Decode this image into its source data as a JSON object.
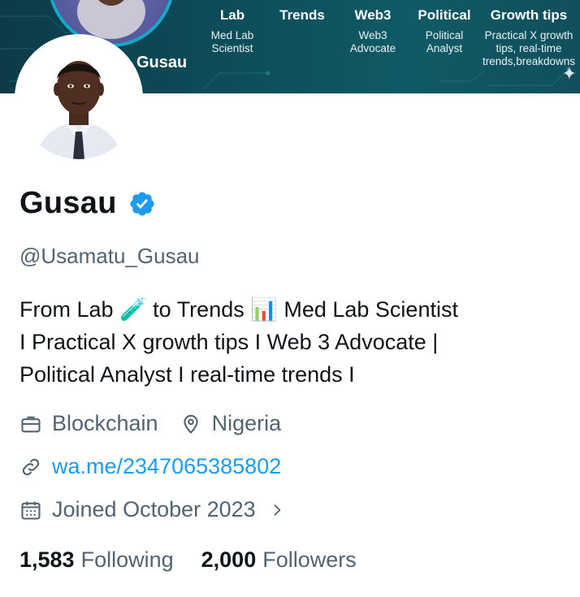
{
  "banner": {
    "name": "Gusau",
    "columns": [
      {
        "title": "Lab",
        "desc": [
          "Med Lab",
          "Scientist"
        ]
      },
      {
        "title": "Trends",
        "desc": []
      },
      {
        "title": "Web3",
        "desc": [
          "Web3",
          "Advocate"
        ]
      },
      {
        "title": "Political",
        "desc": [
          "Political",
          "Analyst"
        ]
      },
      {
        "title": "Growth tips",
        "desc": [
          "Practical X growth",
          "tips, real-time",
          "trends,breakdowns"
        ]
      }
    ]
  },
  "profile": {
    "display_name": "Gusau",
    "handle": "@Usamatu_Gusau",
    "bio_lines": [
      "From Lab 🧪 to Trends 📊 Med Lab Scientist",
      "I Practical X growth tips I Web 3 Advocate |",
      "Political Analyst I real-time trends I"
    ],
    "category": "Blockchain",
    "location": "Nigeria",
    "website": "wa.me/2347065385802",
    "joined": "Joined October 2023",
    "following_count": "1,583",
    "following_label": "Following",
    "followers_count": "2,000",
    "followers_label": "Followers"
  },
  "icons": {
    "category": "briefcase-icon",
    "location": "location-pin-icon",
    "website": "link-icon",
    "joined": "calendar-icon",
    "verified": "verified-badge-icon",
    "chevron": "chevron-right-icon"
  },
  "colors": {
    "banner": "#0e4a57",
    "verified": "#1d9bf0",
    "link": "#1d9bf0",
    "secondary_text": "#536471",
    "primary_text": "#0f1419"
  }
}
